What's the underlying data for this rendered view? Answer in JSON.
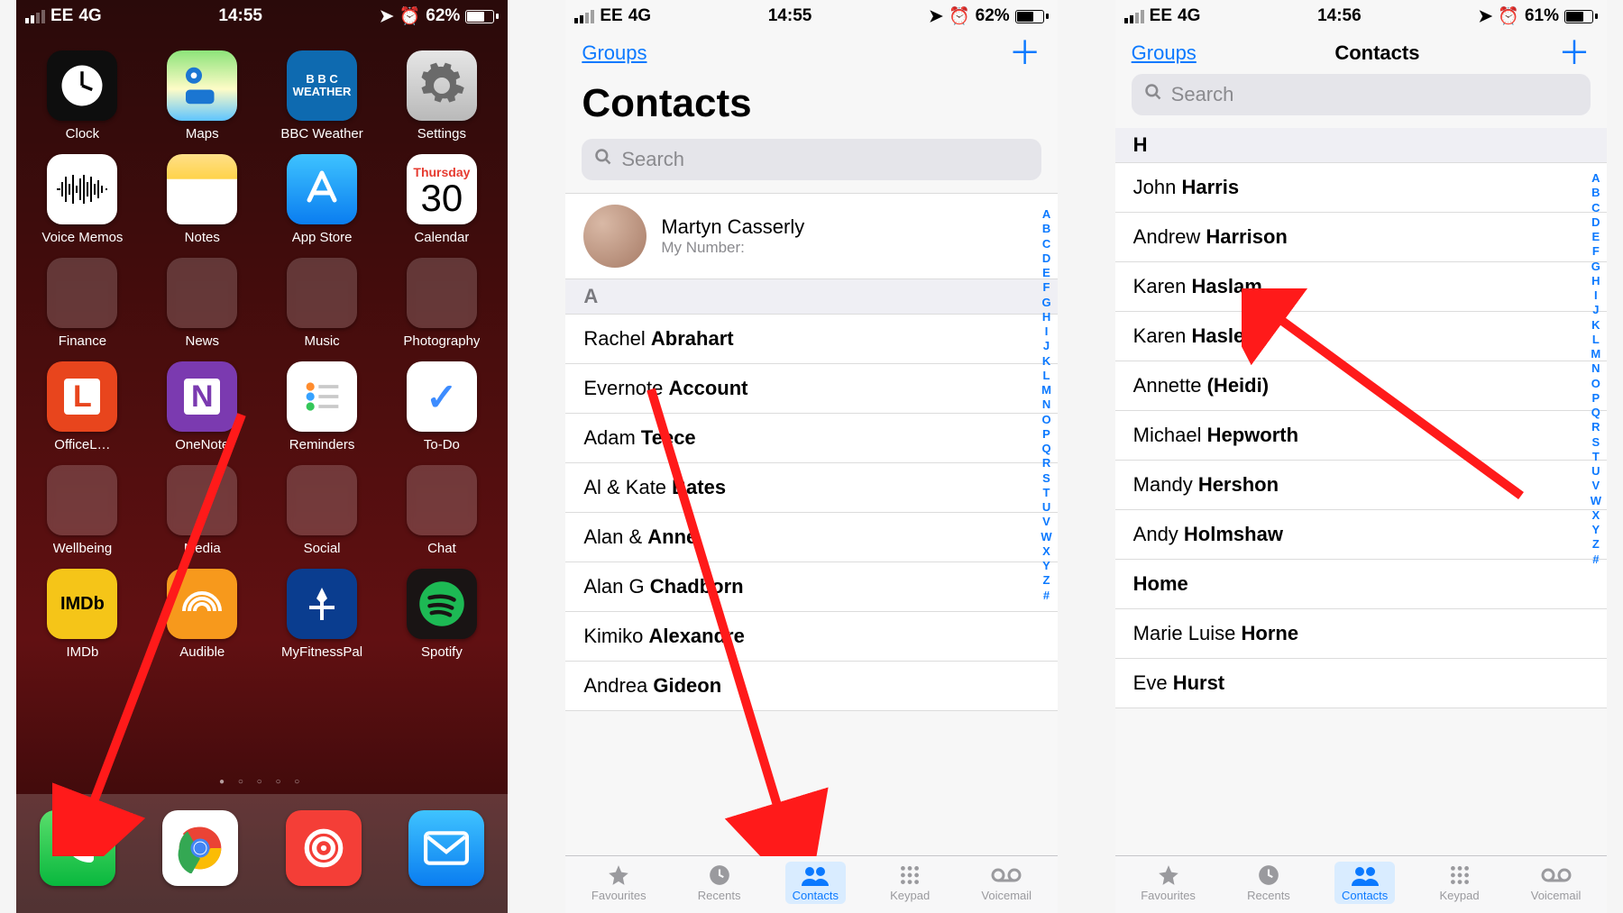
{
  "status_home": {
    "carrier": "EE",
    "net": "4G",
    "time": "14:55",
    "battery_pct": "62%"
  },
  "status_s2": {
    "carrier": "EE",
    "net": "4G",
    "time": "14:55",
    "battery_pct": "62%"
  },
  "status_s3": {
    "carrier": "EE",
    "net": "4G",
    "time": "14:56",
    "battery_pct": "61%"
  },
  "home": {
    "apps": [
      {
        "name": "Clock",
        "bg": "#0e0e0e",
        "fg": "#fff",
        "glyph": "clock"
      },
      {
        "name": "Maps",
        "bg": "linear-gradient(#8de37a,#fefcc7 55%,#5ec4ff)",
        "fg": "#1670b9",
        "glyph": "maps"
      },
      {
        "name": "BBC Weather",
        "bg": "#0e6ab0",
        "fg": "#fff",
        "glyph": "bbc"
      },
      {
        "name": "Settings",
        "bg": "linear-gradient(#e6e6e6,#b9b9b9)",
        "fg": "#6a6a6a",
        "glyph": "gear"
      },
      {
        "name": "Voice Memos",
        "bg": "#ffffff",
        "fg": "#000",
        "glyph": "wave"
      },
      {
        "name": "Notes",
        "bg": "linear-gradient(#ffe089,#ffd34a 35%,#ffffff 36%)",
        "fg": "#b9b9b9",
        "glyph": ""
      },
      {
        "name": "App Store",
        "bg": "linear-gradient(#3ec3ff,#0a7df0)",
        "fg": "#fff",
        "glyph": "A"
      },
      {
        "name": "Calendar",
        "bg": "#ffffff",
        "fg": "#000",
        "glyph": "cal",
        "dow": "Thursday",
        "day": "30"
      },
      {
        "name": "Finance",
        "folder": true,
        "chips": [
          "#1d5ed0",
          "#0b9d58",
          "#ff6a3d",
          "#ff9e2c",
          "#1fb6ff",
          "#734bd1",
          "#ffcf3f",
          "#ef4444",
          "#413f9e"
        ]
      },
      {
        "name": "News",
        "folder": true,
        "chips": [
          "#e74c3c",
          "#ffffff",
          "#e44b6b",
          "#16a085",
          "#f39c12",
          "#e64545",
          "#e7434b",
          "#375a9e",
          "#9e9e9e"
        ]
      },
      {
        "name": "Music",
        "folder": true,
        "chips": [
          "#e44b6b",
          "#2e2e2e",
          "#ff7a30",
          "#3a3a3a",
          "#9e9e9e",
          "#9e9e9e",
          "#9e9e9e",
          "#9e9e9e",
          "#9e9e9e"
        ]
      },
      {
        "name": "Photography",
        "folder": true,
        "chips": [
          "#ffffff",
          "#3cba54",
          "#db3236",
          "#4885ed",
          "#222222",
          "#f4c20d",
          "#9e9e9e",
          "#222222",
          "#9e9e9e"
        ]
      },
      {
        "name": "OfficeL…",
        "bg": "#e8451d",
        "fg": "#fff",
        "glyph": "L"
      },
      {
        "name": "OneNote",
        "bg": "#7b3ab0",
        "fg": "#fff",
        "glyph": "N"
      },
      {
        "name": "Reminders",
        "bg": "#ffffff",
        "fg": "#000",
        "glyph": "rem"
      },
      {
        "name": "To-Do",
        "bg": "#ffffff",
        "fg": "#3d8cff",
        "glyph": "✓"
      },
      {
        "name": "Wellbeing",
        "folder": true,
        "chips": [
          "#ffd54a",
          "#7b3ab0",
          "#1fb6ff",
          "#2c3e50",
          "#ff7a30",
          "#2ecc71",
          "#3498db",
          "#f39c12",
          "#9e9e9e"
        ]
      },
      {
        "name": "Media",
        "folder": true,
        "chips": [
          "#ff0000",
          "#e0e0e0",
          "#354a7a",
          "#ff5f1f",
          "#111111",
          "#9e9e9e",
          "#9e9e9e",
          "#9e9e9e",
          "#9e9e9e"
        ]
      },
      {
        "name": "Social",
        "folder": true,
        "chips": [
          "#4267B2",
          "#1da1f2",
          "#e1306c",
          "#e60023",
          "#b68030",
          "#00aff0",
          "#9e9e9e",
          "#9e9e9e",
          "#9e9e9e"
        ]
      },
      {
        "name": "Chat",
        "folder": true,
        "chips": [
          "#34c759",
          "#25d366",
          "#fffc00",
          "#00aff0",
          "#07c160",
          "#9e9e9e",
          "#9e9e9e",
          "#9e9e9e",
          "#9e9e9e"
        ]
      },
      {
        "name": "IMDb",
        "bg": "#f5c518",
        "fg": "#000",
        "glyph": "IMDb"
      },
      {
        "name": "Audible",
        "bg": "#f7991c",
        "fg": "#fff",
        "glyph": "aud"
      },
      {
        "name": "MyFitnessPal",
        "bg": "#0a3d8f",
        "fg": "#fff",
        "glyph": "mfp"
      },
      {
        "name": "Spotify",
        "bg": "#191414",
        "fg": "#1db954",
        "glyph": "spot"
      }
    ],
    "dock": [
      {
        "name": "Phone",
        "bg": "linear-gradient(#5ade6c,#09b83e)",
        "glyph": "phone"
      },
      {
        "name": "Chrome",
        "bg": "#ffffff",
        "glyph": "chrome"
      },
      {
        "name": "Pocket Casts",
        "bg": "#f43e37",
        "glyph": "pocket"
      },
      {
        "name": "Mail",
        "bg": "linear-gradient(#3fc3ff,#0a7df0)",
        "glyph": "mail"
      }
    ]
  },
  "s2": {
    "groups_label": "Groups",
    "title": "Contacts",
    "search_placeholder": "Search",
    "me": {
      "name": "Martyn Casserly",
      "sub": "My Number:"
    },
    "sectionA": "A",
    "contacts": [
      {
        "first": "Rachel",
        "last": "Abrahart"
      },
      {
        "first": "Evernote",
        "last": "Account"
      },
      {
        "first": "Adam",
        "last": "Teece"
      },
      {
        "first": "Al & Kate",
        "last": "Bates"
      },
      {
        "first": "Alan &",
        "last": "Anne"
      },
      {
        "first": "Alan G",
        "last": "Chadborn"
      },
      {
        "first": "Kimiko",
        "last": "Alexandre"
      },
      {
        "first": "Andrea",
        "last": "Gideon"
      }
    ],
    "index": [
      "A",
      "B",
      "C",
      "D",
      "E",
      "F",
      "G",
      "H",
      "I",
      "J",
      "K",
      "L",
      "M",
      "N",
      "O",
      "P",
      "Q",
      "R",
      "S",
      "T",
      "U",
      "V",
      "W",
      "X",
      "Y",
      "Z",
      "#"
    ],
    "tabs": {
      "fav": "Favourites",
      "rec": "Recents",
      "con": "Contacts",
      "key": "Keypad",
      "vm": "Voicemail"
    }
  },
  "s3": {
    "groups_label": "Groups",
    "title": "Contacts",
    "search_placeholder": "Search",
    "sectionH": "H",
    "contacts": [
      {
        "first": "John",
        "last": "Harris"
      },
      {
        "first": "Andrew",
        "last": "Harrison"
      },
      {
        "first": "Karen",
        "last": "Haslam"
      },
      {
        "first": "Karen",
        "last": "Haslem"
      },
      {
        "first": "Annette",
        "last": "(Heidi)"
      },
      {
        "first": "Michael",
        "last": "Hepworth"
      },
      {
        "first": "Mandy",
        "last": "Hershon"
      },
      {
        "first": "Andy",
        "last": "Holmshaw"
      },
      {
        "first": "",
        "last": "Home"
      },
      {
        "first": "Marie Luise",
        "last": "Horne"
      },
      {
        "first": "Eve",
        "last": "Hurst"
      }
    ],
    "index": [
      "A",
      "B",
      "C",
      "D",
      "E",
      "F",
      "G",
      "H",
      "I",
      "J",
      "K",
      "L",
      "M",
      "N",
      "O",
      "P",
      "Q",
      "R",
      "S",
      "T",
      "U",
      "V",
      "W",
      "X",
      "Y",
      "Z",
      "#"
    ],
    "tabs": {
      "fav": "Favourites",
      "rec": "Recents",
      "con": "Contacts",
      "key": "Keypad",
      "vm": "Voicemail"
    }
  }
}
